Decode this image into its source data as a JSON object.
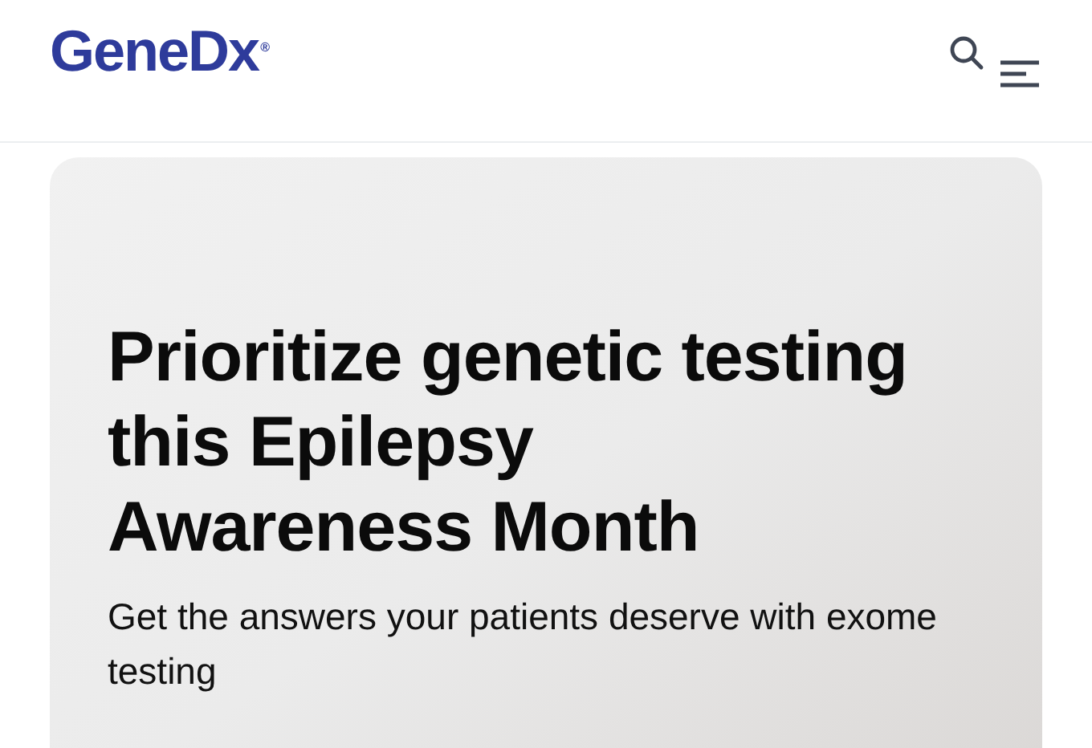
{
  "header": {
    "logo": {
      "name": "GeneDx",
      "mark": "®"
    }
  },
  "hero": {
    "title": "Prioritize genetic testing this Epilepsy Awareness Month",
    "subtitle": "Get the answers your patients deserve with exome testing"
  }
}
